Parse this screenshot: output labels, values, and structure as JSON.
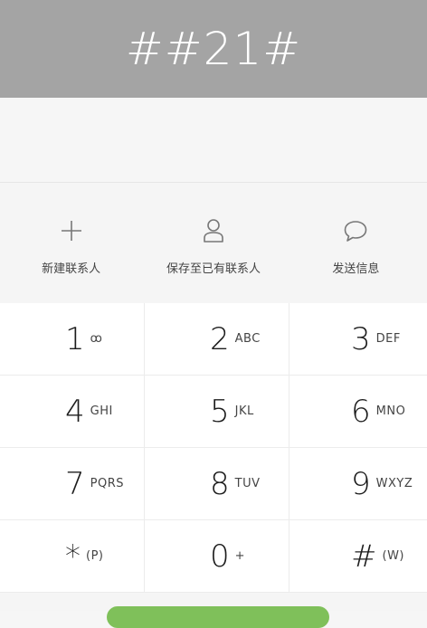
{
  "dial_display": {
    "value": "##21#"
  },
  "actions": [
    {
      "label": "新建联系人",
      "icon": "plus-icon"
    },
    {
      "label": "保存至已有联系人",
      "icon": "person-icon"
    },
    {
      "label": "发送信息",
      "icon": "message-bubble-icon"
    }
  ],
  "keypad": {
    "keys": [
      {
        "digit": "1",
        "sub": "ꝏ"
      },
      {
        "digit": "2",
        "sub": "ABC"
      },
      {
        "digit": "3",
        "sub": "DEF"
      },
      {
        "digit": "4",
        "sub": "GHI"
      },
      {
        "digit": "5",
        "sub": "JKL"
      },
      {
        "digit": "6",
        "sub": "MNO"
      },
      {
        "digit": "7",
        "sub": "PQRS"
      },
      {
        "digit": "8",
        "sub": "TUV"
      },
      {
        "digit": "9",
        "sub": "WXYZ"
      },
      {
        "digit": "*",
        "sub": "(P)"
      },
      {
        "digit": "0",
        "sub": "+"
      },
      {
        "digit": "#",
        "sub": "(W)"
      }
    ]
  },
  "colors": {
    "header_bg": "#a4a4a4",
    "call_button": "#7fc05a"
  }
}
